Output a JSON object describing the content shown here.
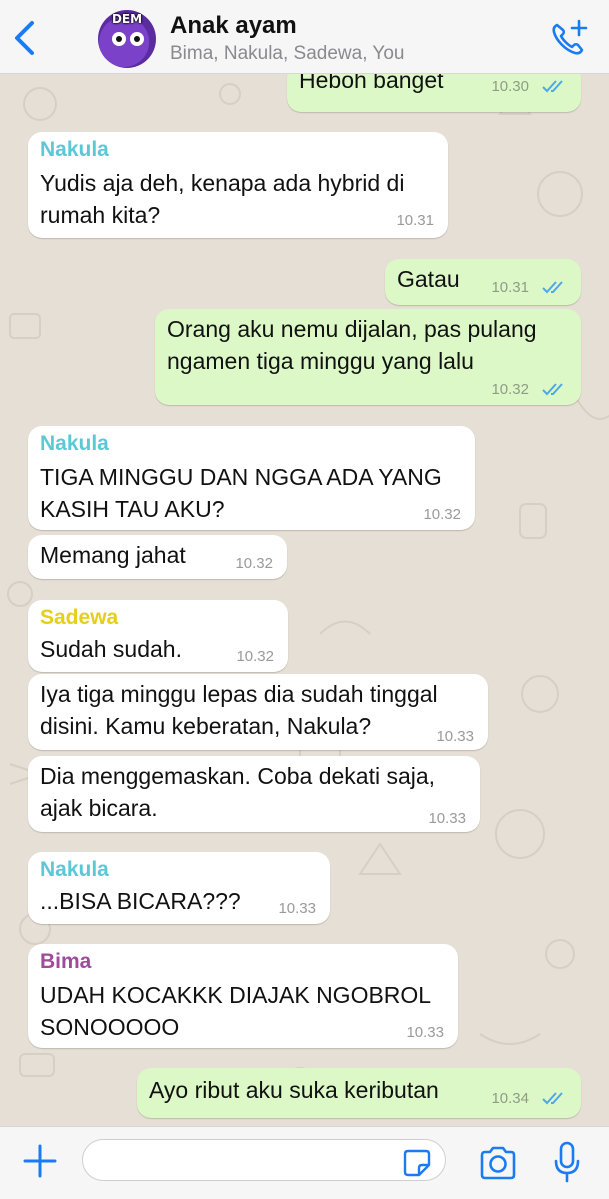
{
  "header": {
    "back_icon": "chevron-left-icon",
    "avatar_text": "DEM",
    "title": "Anak ayam",
    "subtitle": "Bima, Nakula, Sadewa, You",
    "call_icon": "add-call-icon",
    "accent": "#1a7cf2"
  },
  "colors": {
    "incoming": "#ffffff",
    "outgoing": "#dcf8c6",
    "tick_read": "#4fa8e4",
    "nakula": "#5bc8d8",
    "sadewa": "#e4cf1a",
    "bima": "#a04a9a"
  },
  "messages": [
    {
      "dir": "out",
      "text": "Heboh banget",
      "time": "10.30",
      "ticks": "double-check-icon"
    },
    {
      "dir": "in",
      "sender": "Nakula",
      "text": "Yudis aja deh, kenapa ada hybrid di\nrumah kita?",
      "time": "10.31"
    },
    {
      "dir": "out",
      "text": "Gatau",
      "time": "10.31",
      "ticks": "double-check-icon"
    },
    {
      "dir": "out",
      "text": "Orang aku nemu dijalan, pas pulang\nngamen tiga minggu yang lalu",
      "time": "10.32",
      "ticks": "double-check-icon"
    },
    {
      "dir": "in",
      "sender": "Nakula",
      "text": "TIGA MINGGU DAN NGGA ADA YANG\nKASIH TAU AKU?",
      "time": "10.32"
    },
    {
      "dir": "in",
      "text": "Memang jahat",
      "time": "10.32"
    },
    {
      "dir": "in",
      "sender": "Sadewa",
      "text": "Sudah sudah.",
      "time": "10.32"
    },
    {
      "dir": "in",
      "text": "Iya tiga minggu lepas dia sudah tinggal\ndisini. Kamu keberatan, Nakula?",
      "time": "10.33"
    },
    {
      "dir": "in",
      "text": "Dia menggemaskan. Coba dekati saja,\najak bicara.",
      "time": "10.33"
    },
    {
      "dir": "in",
      "sender": "Nakula",
      "text": "...BISA BICARA???",
      "time": "10.33"
    },
    {
      "dir": "in",
      "sender": "Bima",
      "text": "UDAH KOCAKKK DIAJAK NGOBROL\nSONOOOOO",
      "time": "10.33"
    },
    {
      "dir": "out",
      "text": "Ayo ribut aku suka keributan",
      "time": "10.34",
      "ticks": "double-check-icon"
    }
  ],
  "input_bar": {
    "plus_icon": "plus-icon",
    "message_placeholder": "",
    "sticker_icon": "sticker-icon",
    "camera_icon": "camera-icon",
    "mic_icon": "microphone-icon"
  }
}
